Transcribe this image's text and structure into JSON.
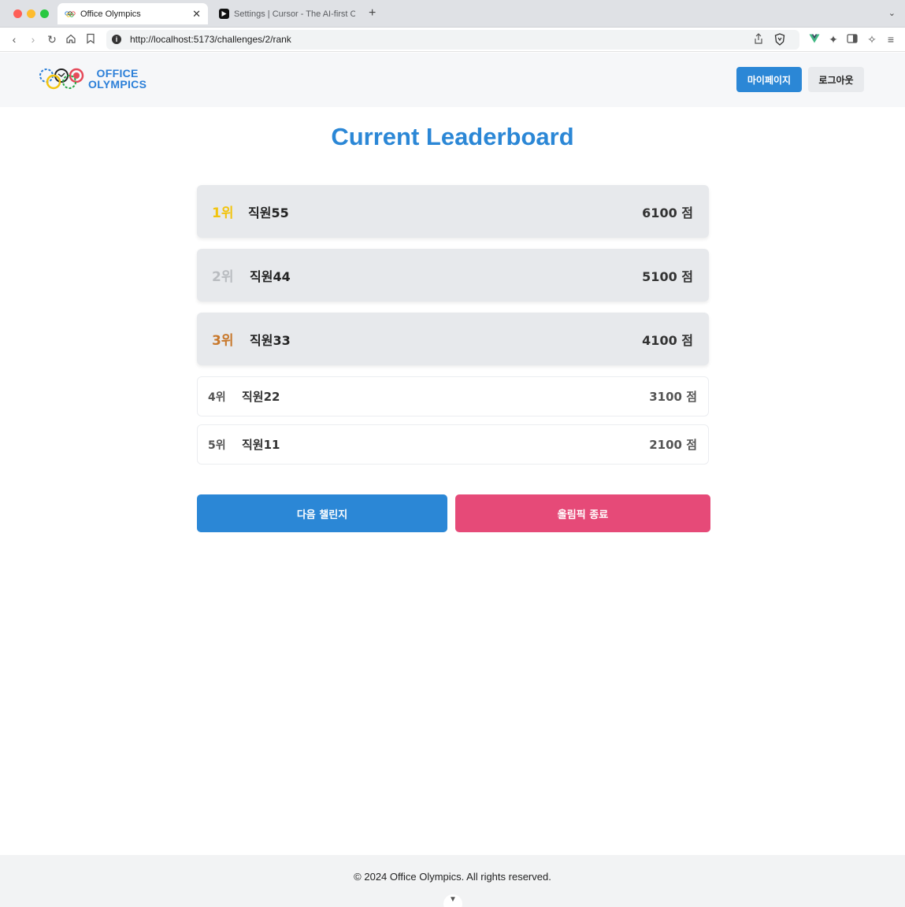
{
  "browser": {
    "tabs": [
      {
        "title": "Office Olympics",
        "active": true
      },
      {
        "title": "Settings | Cursor - The AI-first Co",
        "active": false
      }
    ],
    "url": "http://localhost:5173/challenges/2/rank"
  },
  "header": {
    "logo_line1": "OFFICE",
    "logo_line2": "OLYMPICS",
    "mypage_label": "마이페이지",
    "logout_label": "로그아웃"
  },
  "main": {
    "title": "Current Leaderboard",
    "ranks": [
      {
        "rank": "1위",
        "name": "직원55",
        "score": "6100 점",
        "color": "#f2c40f"
      },
      {
        "rank": "2위",
        "name": "직원44",
        "score": "5100 점",
        "color": "#b9bcc0"
      },
      {
        "rank": "3위",
        "name": "직원33",
        "score": "4100 점",
        "color": "#c8782b"
      },
      {
        "rank": "4위",
        "name": "직원22",
        "score": "3100 점"
      },
      {
        "rank": "5위",
        "name": "직원11",
        "score": "2100 점"
      }
    ],
    "next_label": "다음 챌린지",
    "end_label": "올림픽 종료"
  },
  "footer": {
    "copyright": "© 2024 Office Olympics. All rights reserved."
  },
  "colors": {
    "accent": "#2b87d6",
    "danger": "#e64a78"
  }
}
